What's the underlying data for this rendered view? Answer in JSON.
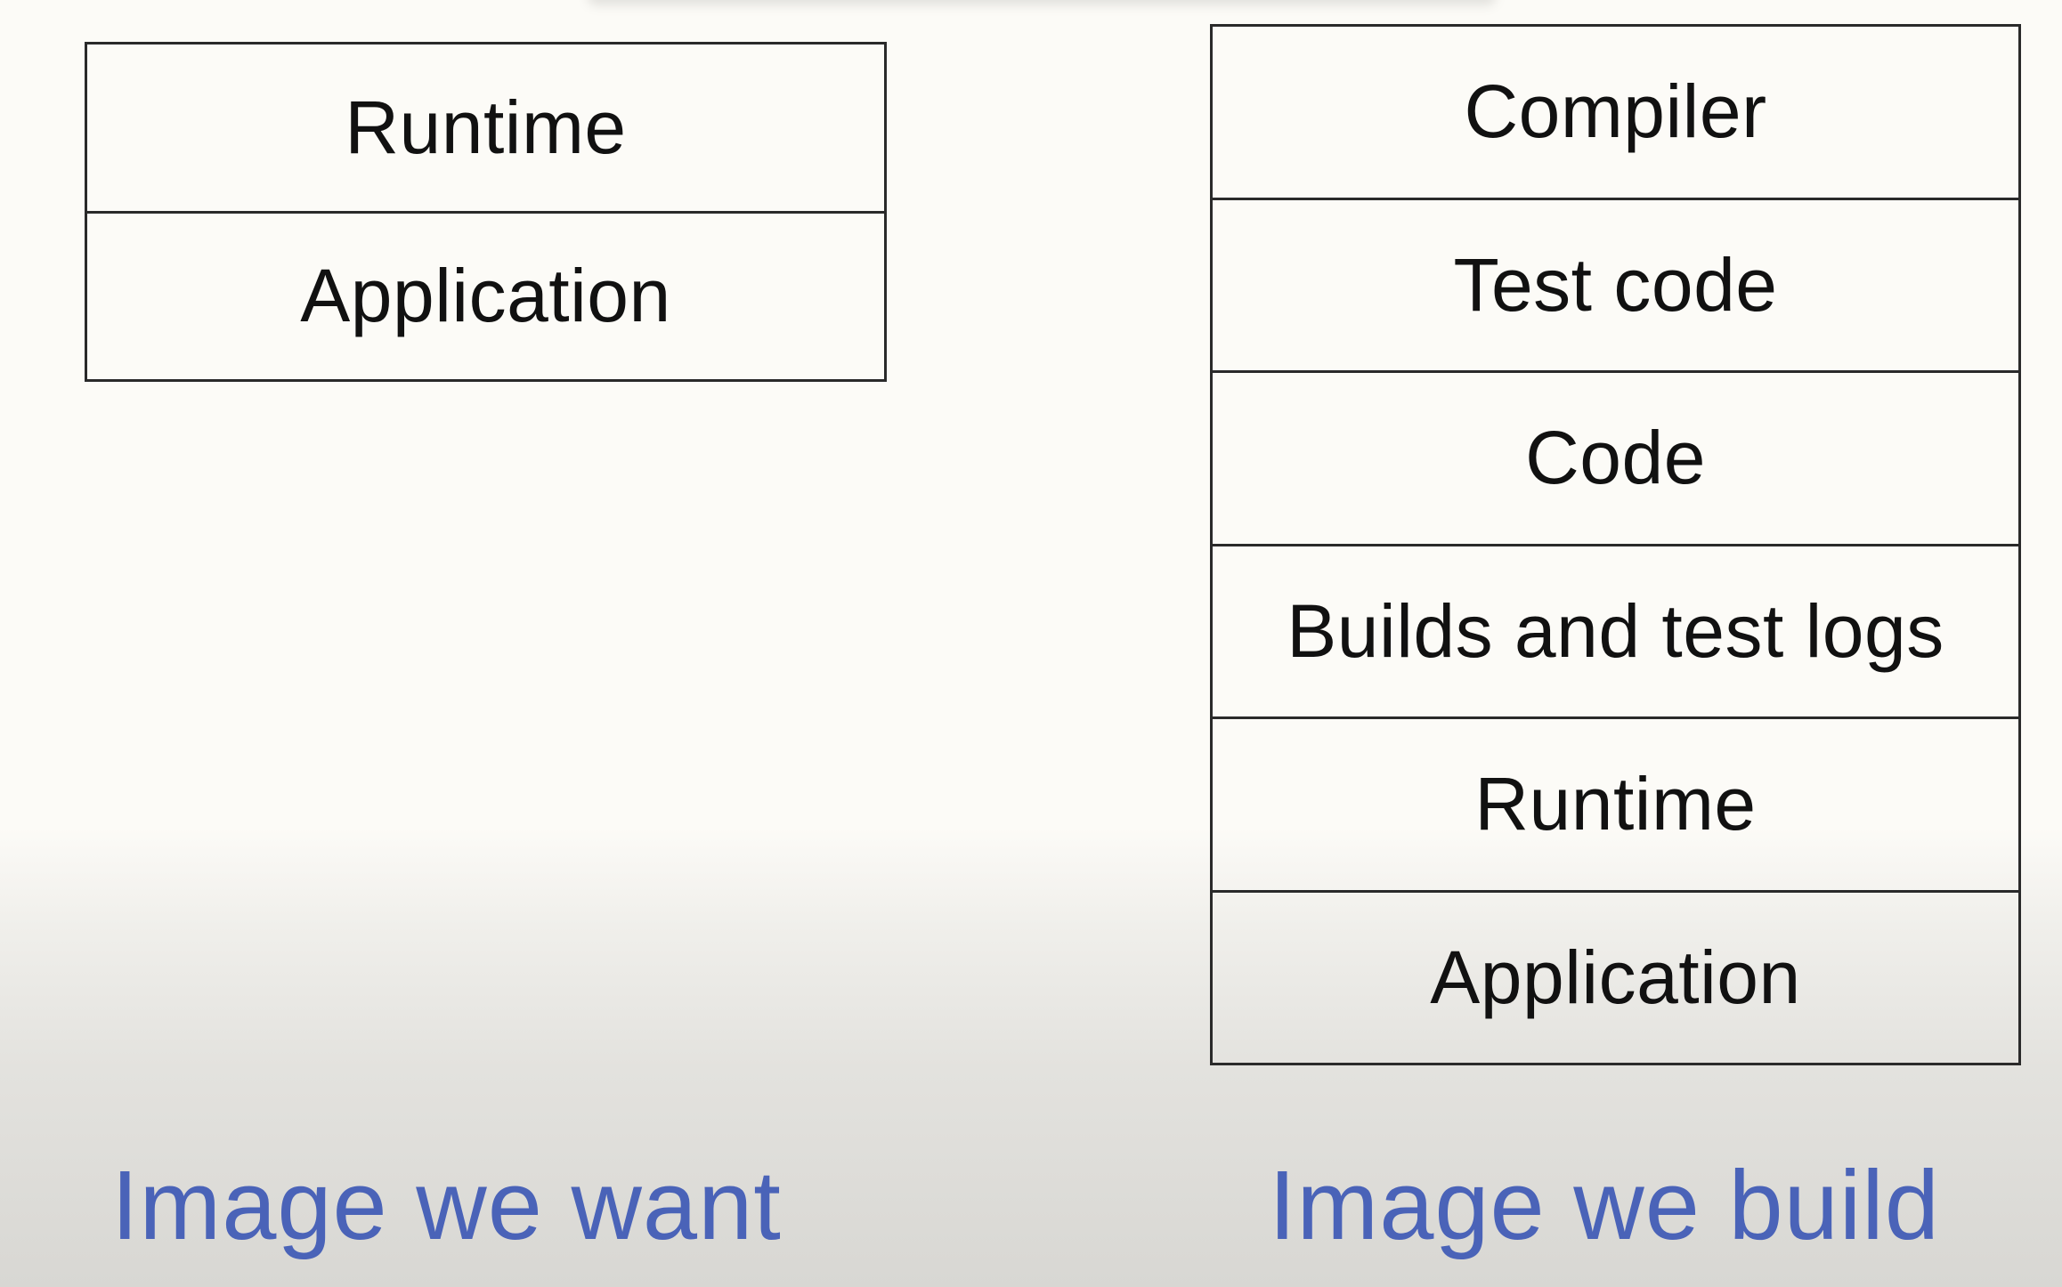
{
  "left_stack": {
    "layers": [
      "Runtime",
      "Application"
    ],
    "caption": "Image we want"
  },
  "right_stack": {
    "layers": [
      "Compiler",
      "Test code",
      "Code",
      "Builds and test logs",
      "Runtime",
      "Application"
    ],
    "caption": "Image we build"
  },
  "colors": {
    "caption": "#4a63b8",
    "border": "#2a2a2a",
    "text": "#111111",
    "background": "#fcfbf7"
  }
}
